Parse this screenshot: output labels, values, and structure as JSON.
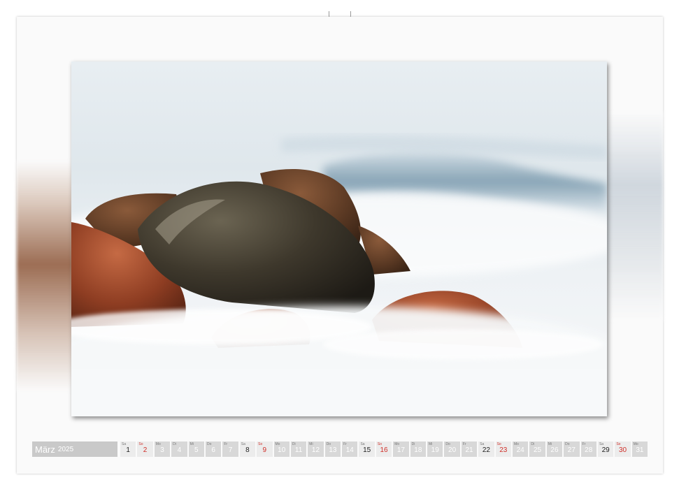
{
  "calendar": {
    "month": "März",
    "year": "2025",
    "days": [
      {
        "num": "1",
        "wd": "Sa",
        "type": "sat"
      },
      {
        "num": "2",
        "wd": "So",
        "type": "sun"
      },
      {
        "num": "3",
        "wd": "Mo",
        "type": "weekday"
      },
      {
        "num": "4",
        "wd": "Di",
        "type": "weekday"
      },
      {
        "num": "5",
        "wd": "Mi",
        "type": "weekday"
      },
      {
        "num": "6",
        "wd": "Do",
        "type": "weekday"
      },
      {
        "num": "7",
        "wd": "Fr",
        "type": "weekday"
      },
      {
        "num": "8",
        "wd": "Sa",
        "type": "sat"
      },
      {
        "num": "9",
        "wd": "So",
        "type": "sun"
      },
      {
        "num": "10",
        "wd": "Mo",
        "type": "weekday"
      },
      {
        "num": "11",
        "wd": "Di",
        "type": "weekday"
      },
      {
        "num": "12",
        "wd": "Mi",
        "type": "weekday"
      },
      {
        "num": "13",
        "wd": "Do",
        "type": "weekday"
      },
      {
        "num": "14",
        "wd": "Fr",
        "type": "weekday"
      },
      {
        "num": "15",
        "wd": "Sa",
        "type": "sat"
      },
      {
        "num": "16",
        "wd": "So",
        "type": "sun"
      },
      {
        "num": "17",
        "wd": "Mo",
        "type": "weekday"
      },
      {
        "num": "18",
        "wd": "Di",
        "type": "weekday"
      },
      {
        "num": "19",
        "wd": "Mi",
        "type": "weekday"
      },
      {
        "num": "20",
        "wd": "Do",
        "type": "weekday"
      },
      {
        "num": "21",
        "wd": "Fr",
        "type": "weekday"
      },
      {
        "num": "22",
        "wd": "Sa",
        "type": "sat"
      },
      {
        "num": "23",
        "wd": "So",
        "type": "sun"
      },
      {
        "num": "24",
        "wd": "Mo",
        "type": "weekday"
      },
      {
        "num": "25",
        "wd": "Di",
        "type": "weekday"
      },
      {
        "num": "26",
        "wd": "Mi",
        "type": "weekday"
      },
      {
        "num": "27",
        "wd": "Do",
        "type": "weekday"
      },
      {
        "num": "28",
        "wd": "Fr",
        "type": "weekday"
      },
      {
        "num": "29",
        "wd": "Sa",
        "type": "sat"
      },
      {
        "num": "30",
        "wd": "So",
        "type": "sun"
      },
      {
        "num": "31",
        "wd": "Mo",
        "type": "weekday"
      }
    ]
  },
  "colors": {
    "sunday_red": "#d0302a",
    "month_bar": "#c9c9c9",
    "rock_red": "#a4482a",
    "rock_dark": "#3b3428",
    "surf_white": "#f3f5f7",
    "wave_blue": "#6d8ea3"
  }
}
